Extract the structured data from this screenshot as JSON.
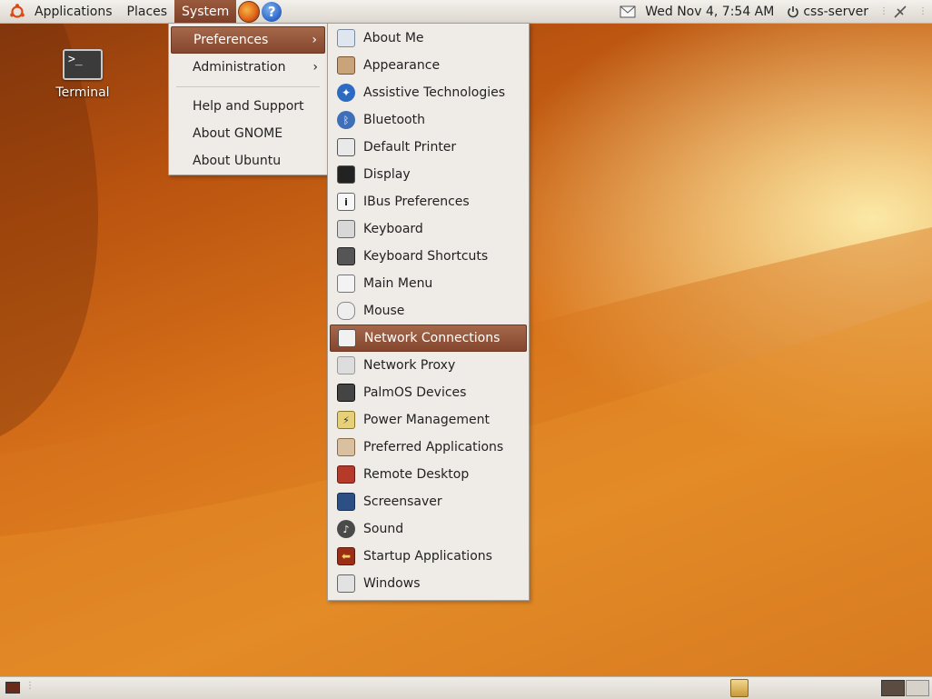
{
  "top_panel": {
    "menus": [
      "Applications",
      "Places",
      "System"
    ],
    "clock": "Wed Nov  4,  7:54 AM",
    "user": "css-server"
  },
  "desktop": {
    "icons": [
      {
        "label": "Terminal",
        "glyph": ">_"
      }
    ]
  },
  "system_menu": {
    "items": [
      "Preferences",
      "Administration",
      "Help and Support",
      "About GNOME",
      "About Ubuntu"
    ],
    "selected": "Preferences"
  },
  "preferences_menu": {
    "items": [
      {
        "label": "About Me",
        "icon": "about-me-icon"
      },
      {
        "label": "Appearance",
        "icon": "appearance-icon"
      },
      {
        "label": "Assistive Technologies",
        "icon": "accessibility-icon"
      },
      {
        "label": "Bluetooth",
        "icon": "bluetooth-icon"
      },
      {
        "label": "Default Printer",
        "icon": "printer-icon"
      },
      {
        "label": "Display",
        "icon": "display-icon"
      },
      {
        "label": "IBus Preferences",
        "icon": "info-icon"
      },
      {
        "label": "Keyboard",
        "icon": "keyboard-icon"
      },
      {
        "label": "Keyboard Shortcuts",
        "icon": "keyboard-shortcuts-icon"
      },
      {
        "label": "Main Menu",
        "icon": "main-menu-icon"
      },
      {
        "label": "Mouse",
        "icon": "mouse-icon"
      },
      {
        "label": "Network Connections",
        "icon": "network-icon"
      },
      {
        "label": "Network Proxy",
        "icon": "proxy-icon"
      },
      {
        "label": "PalmOS Devices",
        "icon": "palm-device-icon"
      },
      {
        "label": "Power Management",
        "icon": "power-icon"
      },
      {
        "label": "Preferred Applications",
        "icon": "preferred-apps-icon"
      },
      {
        "label": "Remote Desktop",
        "icon": "remote-desktop-icon"
      },
      {
        "label": "Screensaver",
        "icon": "screensaver-icon"
      },
      {
        "label": "Sound",
        "icon": "sound-icon"
      },
      {
        "label": "Startup Applications",
        "icon": "startup-icon"
      },
      {
        "label": "Windows",
        "icon": "windows-icon"
      }
    ],
    "selected": "Network Connections"
  },
  "colors": {
    "selection": "#8f5037",
    "menu_bg": "#efebe7",
    "wallpaper_accent": "#e8962a"
  }
}
